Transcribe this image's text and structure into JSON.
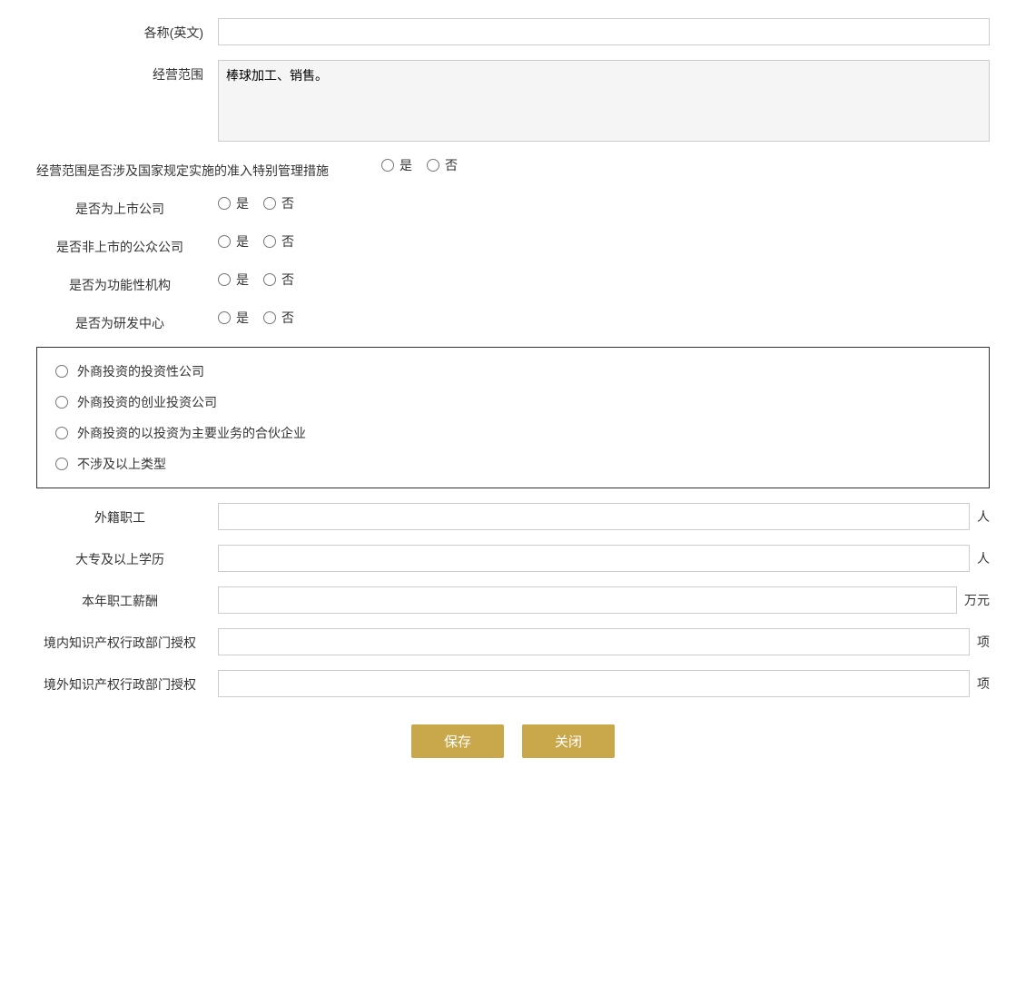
{
  "form": {
    "english_name_label": "各称(英文)",
    "english_name_value": "",
    "business_scope_label": "经营范围",
    "business_scope_value": "棒球加工、销售。",
    "special_management_label": "经营范围是否涉及国家规定实施的准入特别管理措施",
    "special_management_yes": "是",
    "special_management_no": "否",
    "listed_company_label": "是否为上市公司",
    "listed_company_yes": "是",
    "listed_company_no": "否",
    "non_listed_public_label": "是否非上市的公众公司",
    "non_listed_public_yes": "是",
    "non_listed_public_no": "否",
    "functional_institution_label": "是否为功能性机构",
    "functional_institution_yes": "是",
    "functional_institution_no": "否",
    "rd_center_label": "是否为研发中心",
    "rd_center_yes": "是",
    "rd_center_no": "否",
    "investment_company_option": "外商投资的投资性公司",
    "venture_capital_option": "外商投资的创业投资公司",
    "partnership_option": "外商投资的以投资为主要业务的合伙企业",
    "not_applicable_option": "不涉及以上类型",
    "foreign_employees_label": "外籍职工",
    "foreign_employees_unit": "人",
    "college_education_label": "大专及以上学历",
    "college_education_unit": "人",
    "annual_salary_label": "本年职工薪酬",
    "annual_salary_unit": "万元",
    "domestic_ip_label": "境内知识产权行政部门授权",
    "domestic_ip_unit": "项",
    "overseas_ip_label": "境外知识产权行政部门授权",
    "overseas_ip_unit": "项",
    "save_button": "保存",
    "close_button": "关闭"
  }
}
